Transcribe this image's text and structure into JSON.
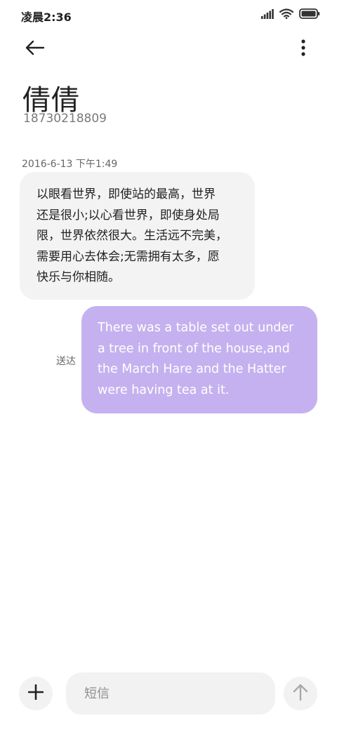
{
  "status_bar": {
    "time": "凌晨2:36",
    "icons": [
      "signal-icon",
      "wifi-icon",
      "battery-icon"
    ]
  },
  "header": {
    "back_icon": "arrow-left-icon",
    "more_icon": "more-vertical-icon"
  },
  "contact": {
    "name": "倩倩",
    "number": "18730218809"
  },
  "conversation": {
    "timestamp": "2016-6-13 下午1:49",
    "incoming": {
      "text": "以眼看世界，即使站的最高，世界\n还是很小;以心看世界，即使身处局\n限，世界依然很大。生活远不完美，\n需要用心去体会;无需拥有太多，愿\n快乐与你相随。"
    },
    "outgoing": {
      "status": "送达",
      "text": "There was a table set out under\na tree in front of the house,and\nthe March Hare and the Hatter\nwere having tea at it."
    }
  },
  "composer": {
    "placeholder": "短信",
    "add_icon": "plus-icon",
    "send_icon": "arrow-up-icon"
  },
  "colors": {
    "outgoing_bubble": "#c5b1ef",
    "incoming_bubble": "#f3f3f3",
    "control_bg": "#f2f2f2"
  }
}
